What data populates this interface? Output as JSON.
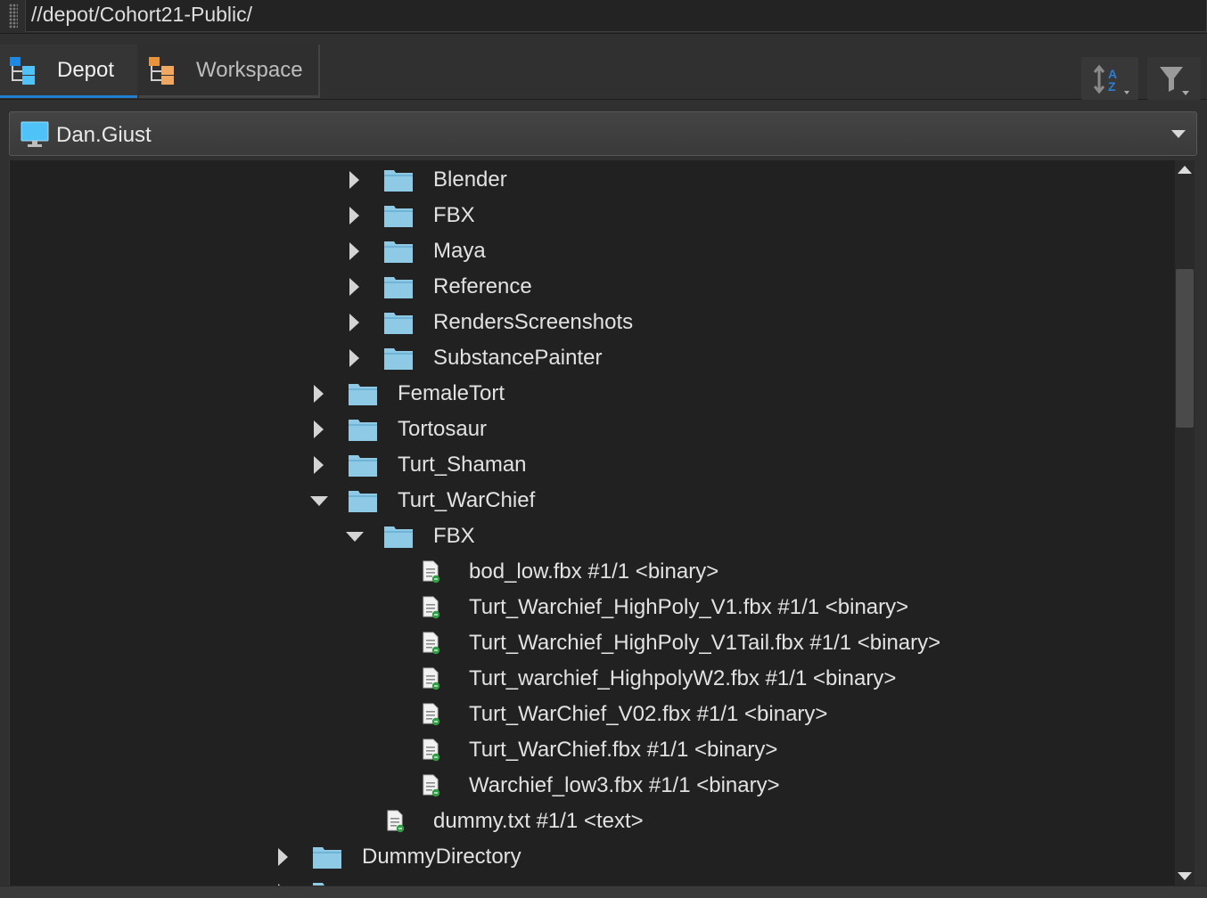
{
  "path": "//depot/Cohort21-Public/",
  "tabs": {
    "depot": {
      "label": "Depot",
      "icon": "depot-tree-icon",
      "active": true
    },
    "workspace": {
      "label": "Workspace",
      "icon": "workspace-tree-icon",
      "active": false
    }
  },
  "toolbar": {
    "sort_icon": "sort-az-icon",
    "filter_icon": "filter-icon"
  },
  "workspace_selector": {
    "value": "Dan.Giust",
    "icon": "computer-monitor-icon"
  },
  "colors": {
    "accent": "#1f7fd0",
    "folder": "#8ecae6",
    "file_badge": "#2ea043",
    "monitor": "#4fc3f7",
    "workspace_icon": "#f0a860"
  },
  "tree": {
    "rows": [
      {
        "type": "folder",
        "label": "Blender",
        "level": 2,
        "state": "collapsed"
      },
      {
        "type": "folder",
        "label": "FBX",
        "level": 2,
        "state": "collapsed"
      },
      {
        "type": "folder",
        "label": "Maya",
        "level": 2,
        "state": "collapsed"
      },
      {
        "type": "folder",
        "label": "Reference",
        "level": 2,
        "state": "collapsed"
      },
      {
        "type": "folder",
        "label": "RendersScreenshots",
        "level": 2,
        "state": "collapsed"
      },
      {
        "type": "folder",
        "label": "SubstancePainter",
        "level": 2,
        "state": "collapsed"
      },
      {
        "type": "folder",
        "label": "FemaleTort",
        "level": 1,
        "state": "collapsed"
      },
      {
        "type": "folder",
        "label": "Tortosaur",
        "level": 1,
        "state": "collapsed"
      },
      {
        "type": "folder",
        "label": "Turt_Shaman",
        "level": 1,
        "state": "collapsed"
      },
      {
        "type": "folder",
        "label": "Turt_WarChief",
        "level": 1,
        "state": "expanded"
      },
      {
        "type": "folder",
        "label": "FBX",
        "level": 2,
        "state": "expanded"
      },
      {
        "type": "file",
        "label": "bod_low.fbx #1/1 <binary>",
        "level": 3
      },
      {
        "type": "file",
        "label": "Turt_Warchief_HighPoly_V1.fbx #1/1 <binary>",
        "level": 3
      },
      {
        "type": "file",
        "label": "Turt_Warchief_HighPoly_V1Tail.fbx #1/1 <binary>",
        "level": 3
      },
      {
        "type": "file",
        "label": "Turt_warchief_HighpolyW2.fbx #1/1 <binary>",
        "level": 3
      },
      {
        "type": "file",
        "label": "Turt_WarChief_V02.fbx #1/1 <binary>",
        "level": 3
      },
      {
        "type": "file",
        "label": "Turt_WarChief.fbx #1/1 <binary>",
        "level": 3
      },
      {
        "type": "file",
        "label": "Warchief_low3.fbx #1/1 <binary>",
        "level": 3
      },
      {
        "type": "file",
        "label": "dummy.txt #1/1 <text>",
        "level": 2
      },
      {
        "type": "folder",
        "label": "DummyDirectory",
        "level": 0,
        "state": "collapsed"
      },
      {
        "type": "folder",
        "label": "",
        "level": 0,
        "state": "collapsed"
      }
    ]
  }
}
